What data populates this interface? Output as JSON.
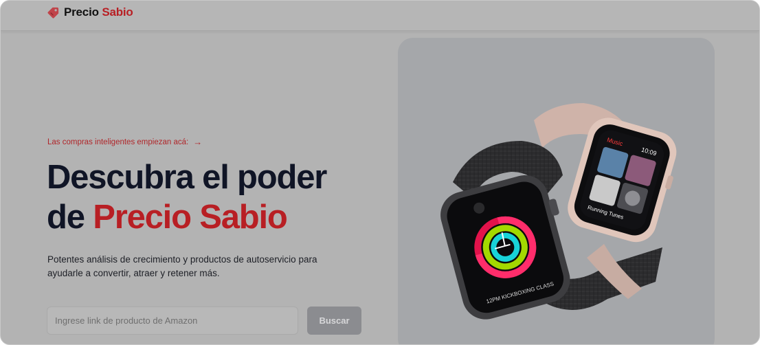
{
  "header": {
    "brand_part1": "Precio",
    "brand_part2": "Sabio",
    "logo_icon": "price-tag-icon"
  },
  "hero": {
    "tagline": "Las compras inteligentes empiezan acá:",
    "tagline_icon": "arrow-right-icon",
    "headline_line1": "Descubra el poder",
    "headline_prefix": "de",
    "headline_accent": "Precio Sabio",
    "description": "Potentes análisis de crecimiento y productos de autoservicio para ayudarle a convertir, atraer y retener más."
  },
  "search": {
    "placeholder": "Ingrese link de producto de Amazon",
    "value": "",
    "button_label": "Buscar"
  },
  "product_image": {
    "screen_app_title": "Music",
    "screen_time": "10:09",
    "screen_playlist": "Running Tunes",
    "band_text": "12PM KICKBOXING CLASS"
  },
  "colors": {
    "accent": "#b81f24",
    "heading": "#101526",
    "overlay_background": "#b3b3b3",
    "button": "#8b8c90"
  }
}
